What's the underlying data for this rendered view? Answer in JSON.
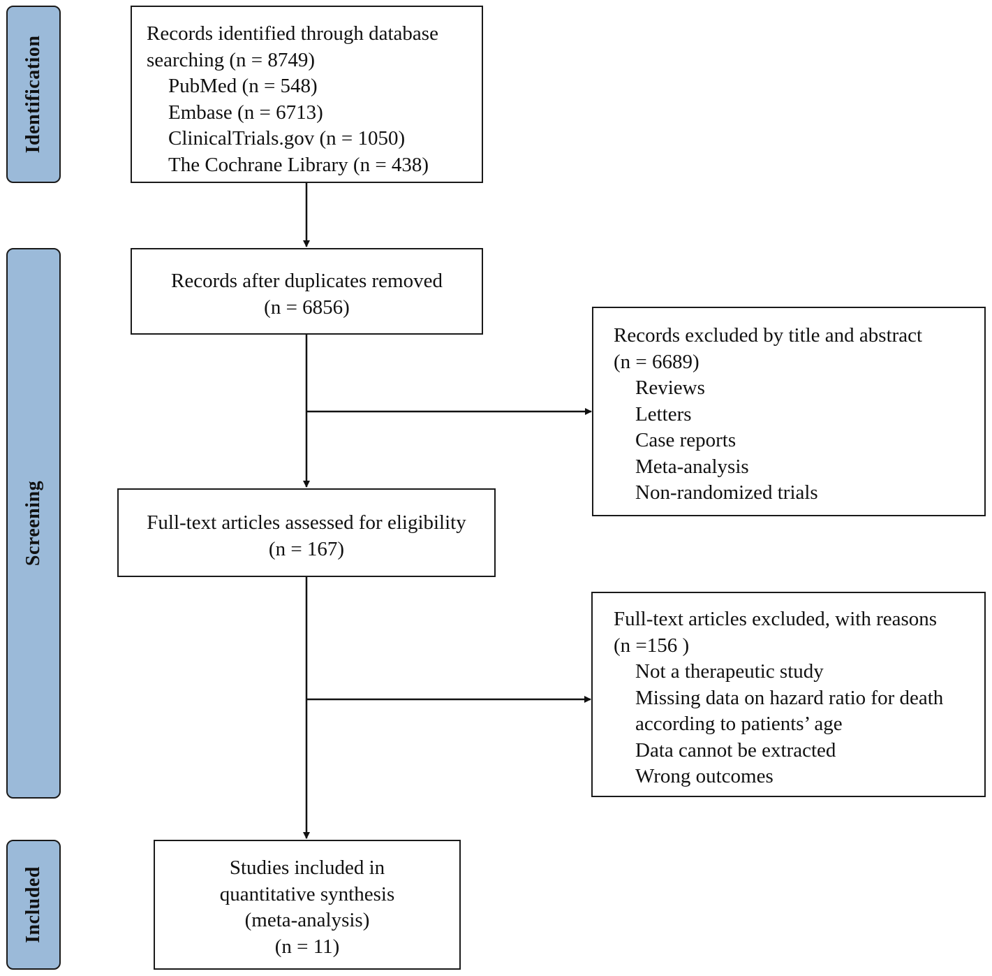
{
  "phases": {
    "identification": "Identification",
    "screening": "Screening",
    "included": "Included"
  },
  "boxes": {
    "identified": {
      "lines": [
        "Records identified through database",
        "searching (n = 8749)"
      ],
      "sources": [
        "PubMed (n = 548)",
        "Embase (n = 6713)",
        "ClinicalTrials.gov (n = 1050)",
        "The Cochrane Library (n = 438)"
      ]
    },
    "after_duplicates": {
      "lines": [
        "Records after duplicates removed",
        "(n = 6856)"
      ]
    },
    "excluded_title_abstract": {
      "lines": [
        "Records excluded by title and abstract",
        "(n = 6689)"
      ],
      "reasons": [
        "Reviews",
        "Letters",
        "Case reports",
        "Meta-analysis",
        "Non-randomized trials"
      ]
    },
    "full_text_assessed": {
      "lines": [
        "Full-text  articles assessed for eligibility",
        "(n = 167)"
      ]
    },
    "full_text_excluded": {
      "lines": [
        "Full-text articles excluded, with reasons",
        "(n =156 )"
      ],
      "reasons": [
        "Not a therapeutic study",
        "Missing data on hazard ratio for death",
        "according to patients’ age",
        "Data cannot be extracted",
        "Wrong outcomes"
      ]
    },
    "included": {
      "lines": [
        "Studies included in",
        "quantitative synthesis",
        "(meta-analysis)",
        "(n = 11)"
      ]
    }
  },
  "colors": {
    "phase_fill": "#9bbad9",
    "stroke": "#1a1a1a"
  }
}
